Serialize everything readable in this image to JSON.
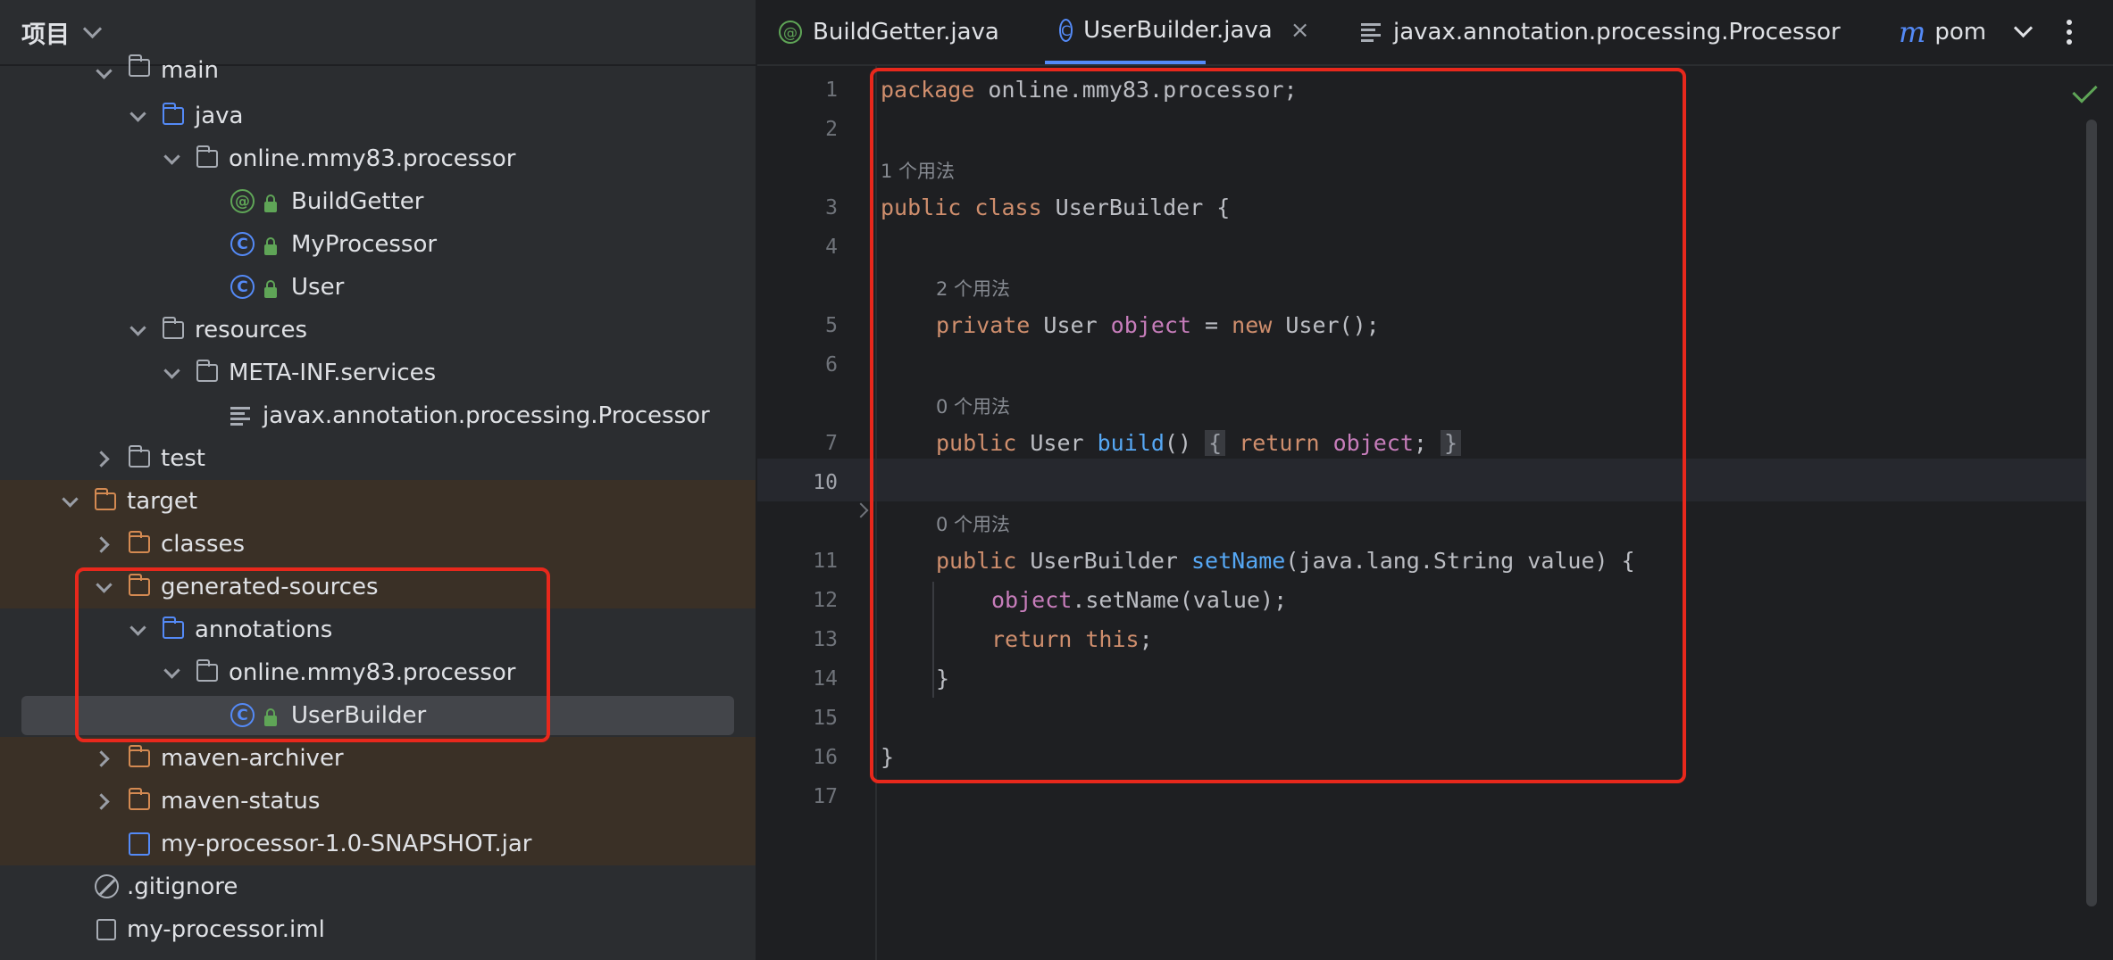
{
  "project_panel": {
    "title": "项目",
    "tree": [
      {
        "label": "main",
        "icon": "folder-icon"
      },
      {
        "label": "java",
        "icon": "source-folder-icon"
      },
      {
        "label": "online.mmy83.processor",
        "icon": "package-icon"
      },
      {
        "label": "BuildGetter",
        "icon": "annotation-icon"
      },
      {
        "label": "MyProcessor",
        "icon": "class-icon"
      },
      {
        "label": "User",
        "icon": "class-icon"
      },
      {
        "label": "resources",
        "icon": "resources-folder-icon"
      },
      {
        "label": "META-INF.services",
        "icon": "folder-icon"
      },
      {
        "label": "javax.annotation.processing.Processor",
        "icon": "text-file-icon"
      },
      {
        "label": "test",
        "icon": "folder-icon"
      },
      {
        "label": "target",
        "icon": "excluded-folder-icon"
      },
      {
        "label": "classes",
        "icon": "excluded-folder-icon"
      },
      {
        "label": "generated-sources",
        "icon": "excluded-folder-icon"
      },
      {
        "label": "annotations",
        "icon": "generated-sources-folder-icon"
      },
      {
        "label": "online.mmy83.processor",
        "icon": "package-icon"
      },
      {
        "label": "UserBuilder",
        "icon": "class-icon"
      },
      {
        "label": "maven-archiver",
        "icon": "excluded-folder-icon"
      },
      {
        "label": "maven-status",
        "icon": "excluded-folder-icon"
      },
      {
        "label": "my-processor-1.0-SNAPSHOT.jar",
        "icon": "jar-icon"
      },
      {
        "label": ".gitignore",
        "icon": "ignore-file-icon"
      },
      {
        "label": "my-processor.iml",
        "icon": "iml-file-icon"
      }
    ]
  },
  "tabs": [
    {
      "label": "BuildGetter.java",
      "icon": "annotation-icon"
    },
    {
      "label": "UserBuilder.java",
      "icon": "class-icon",
      "active": true,
      "close": "×"
    },
    {
      "label": "javax.annotation.processing.Processor",
      "icon": "text-file-icon"
    },
    {
      "label": "pom.",
      "icon": "maven-icon",
      "icon_text": "m"
    }
  ],
  "editor": {
    "line_numbers": [
      "1",
      "2",
      "3",
      "4",
      "5",
      "6",
      "7",
      "10",
      "11",
      "12",
      "13",
      "14",
      "15",
      "16",
      "17"
    ],
    "hints": {
      "h1": "1 个用法",
      "h2": "2 个用法",
      "h3": "0 个用法",
      "h4": "0 个用法"
    },
    "code": {
      "l1_kw": "package",
      "l1_rest": " online.mmy83.processor;",
      "l3_kw": "public class",
      "l3_rest": " UserBuilder {",
      "l5_kw": "private",
      "l5_a": " User ",
      "l5_field": "object",
      "l5_b": " = ",
      "l5_new": "new",
      "l5_c": " User();",
      "l7_kw": "public",
      "l7_a": " User ",
      "l7_fn": "build",
      "l7_b": "()",
      "l7_fold1": "{",
      "l7_ret": "return",
      "l7_field": "object",
      "l7_semi": ";",
      "l7_fold2": "}",
      "l11_kw": "public",
      "l11_a": " UserBuilder ",
      "l11_fn": "setName",
      "l11_b": "(java.lang.String value) {",
      "l12_field": "object",
      "l12_rest": ".setName(value);",
      "l13_kw": "return",
      "l13_this": "this",
      "l13_semi": ";",
      "l14": "}",
      "l16": "}"
    }
  },
  "colors": {
    "keyword": "#cf8e6d",
    "field": "#c77dbb",
    "function": "#56a8f5",
    "highlight_box": "#e8281c"
  }
}
